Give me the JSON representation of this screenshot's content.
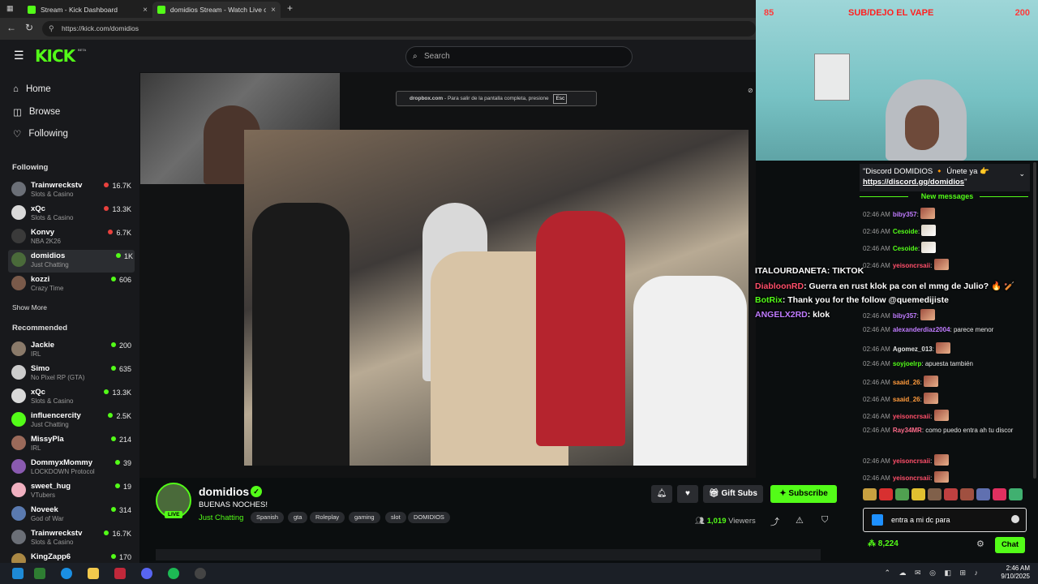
{
  "browser": {
    "tabs": [
      {
        "title": "Stream - Kick Dashboard",
        "close": "×"
      },
      {
        "title": "domidios Stream - Watch Live on",
        "close": "×"
      }
    ],
    "new_tab": "+",
    "url": "https://kick.com/domidios"
  },
  "header": {
    "logo": "KICK",
    "beta": "BETA",
    "search_placeholder": "Search"
  },
  "sidebar": {
    "nav": [
      {
        "label": "Home",
        "icon": "home-icon"
      },
      {
        "label": "Browse",
        "icon": "browse-icon"
      },
      {
        "label": "Following",
        "icon": "heart-icon"
      }
    ],
    "following_title": "Following",
    "following": [
      {
        "name": "Trainwreckstv",
        "category": "Slots & Casino",
        "viewers": "16.7K"
      },
      {
        "name": "xQc",
        "category": "Slots & Casino",
        "viewers": "13.3K"
      },
      {
        "name": "Konvy",
        "category": "NBA 2K26",
        "viewers": "6.7K"
      },
      {
        "name": "domidios",
        "category": "Just Chatting",
        "viewers": "1K"
      },
      {
        "name": "kozzi",
        "category": "Crazy Time",
        "viewers": "606"
      }
    ],
    "show_more": "Show More",
    "recommended_title": "Recommended",
    "recommended": [
      {
        "name": "Jackie",
        "category": "IRL",
        "viewers": "200"
      },
      {
        "name": "Simo",
        "category": "No Pixel RP (GTA)",
        "viewers": "635"
      },
      {
        "name": "xQc",
        "category": "Slots & Casino",
        "viewers": "13.3K"
      },
      {
        "name": "influencercity",
        "category": "Just Chatting",
        "viewers": "2.5K"
      },
      {
        "name": "MissyPla",
        "category": "IRL",
        "viewers": "214"
      },
      {
        "name": "DommyxMommy",
        "category": "LOCKDOWN Protocol",
        "viewers": "39"
      },
      {
        "name": "sweet_hug",
        "category": "VTubers",
        "viewers": "19"
      },
      {
        "name": "Noveek",
        "category": "God of War",
        "viewers": "314"
      },
      {
        "name": "Trainwreckstv",
        "category": "Slots & Casino",
        "viewers": "16.7K"
      },
      {
        "name": "KingZapp6",
        "category": "",
        "viewers": "170"
      }
    ]
  },
  "video": {
    "dropbox_site": "dropbox.com",
    "dropbox_msg": "- Para salir de la pantalla completa, presione",
    "dropbox_key": "Esc"
  },
  "stream": {
    "streamer": "domidios",
    "live": "LIVE",
    "title": "BUENAS NOCHES!",
    "category": "Just Chatting",
    "tags": [
      "Spanish",
      "gta",
      "Roleplay",
      "gaming",
      "slot",
      "DOMIDIOS"
    ],
    "gift_subs": "Gift Subs",
    "subscribe": "Subscribe",
    "viewers_count": "1,019",
    "viewers_label": "Viewers"
  },
  "webcam": {
    "left_num": "85",
    "title": "SUB/DEJO EL VAPE",
    "right_num": "200"
  },
  "overlay": [
    {
      "user": "ITALOURDANETA",
      "text": ": TIKTOK",
      "color": "#ffffff"
    },
    {
      "user": "DiabloonRD",
      "text": ": Guerra en rust klok pa con el mmg de Julio? 🔥 🏏",
      "color": "#ff4f6a"
    },
    {
      "user": "BotRix",
      "text": ": Thank you for the follow @quemedijiste",
      "color": "#53fc18"
    },
    {
      "user": "ANGELX2RD",
      "text": ": klok",
      "color": "#c07cff"
    }
  ],
  "chat": {
    "pinned_text": "\"Discord DOMIDIOS 🔸 Únete ya 👉",
    "pinned_link": "https://discord.gg/domidios",
    "pinned_end": "\"",
    "new_messages": "New messages",
    "messages": [
      {
        "ts": "02:46 AM",
        "user": "biby357",
        "color": "#c07cff",
        "text": "",
        "emote": "emote"
      },
      {
        "ts": "02:46 AM",
        "user": "Cesoide",
        "color": "#53fc18",
        "text": "",
        "emote": "w"
      },
      {
        "ts": "02:46 AM",
        "user": "Cesoide",
        "color": "#53fc18",
        "text": "",
        "emote": "w"
      },
      {
        "ts": "02:46 AM",
        "user": "yeisoncrsaii",
        "color": "#ff4f6a",
        "text": "",
        "emote": "emote"
      },
      {
        "ts": "02:46 AM",
        "user": "biby357",
        "color": "#c07cff",
        "text": "",
        "emote": "emote"
      },
      {
        "ts": "02:46 AM",
        "user": "alexanderdiaz2004",
        "color": "#c07cff",
        "text": "parece menor",
        "emote": ""
      },
      {
        "ts": "02:46 AM",
        "user": "Agomez_013",
        "color": "#e0e0e0",
        "text": "",
        "emote": "emote"
      },
      {
        "ts": "02:46 AM",
        "user": "soyjoelrp",
        "color": "#53fc18",
        "text": "apuesta también",
        "emote": ""
      },
      {
        "ts": "02:46 AM",
        "user": "saaid_26",
        "color": "#ff9a3c",
        "text": "",
        "emote": "emote"
      },
      {
        "ts": "02:46 AM",
        "user": "saaid_26",
        "color": "#ff9a3c",
        "text": "",
        "emote": "emote"
      },
      {
        "ts": "02:46 AM",
        "user": "yeisoncrsaii",
        "color": "#ff4f6a",
        "text": "",
        "emote": "emote"
      },
      {
        "ts": "02:46 AM",
        "user": "Ray34MR",
        "color": "#ff6b8a",
        "text": "como puedo entra ah tu discor",
        "emote": ""
      },
      {
        "ts": "02:46 AM",
        "user": "yeisoncrsaii",
        "color": "#ff4f6a",
        "text": "",
        "emote": "emote"
      },
      {
        "ts": "02:46 AM",
        "user": "yeisoncrsaii",
        "color": "#ff4f6a",
        "text": "",
        "emote": "emote"
      }
    ],
    "input_value": "entra a mi dc para",
    "points": "8,224",
    "send": "Chat"
  },
  "taskbar": {
    "time": "2:46 AM",
    "date": "9/10/2025"
  }
}
